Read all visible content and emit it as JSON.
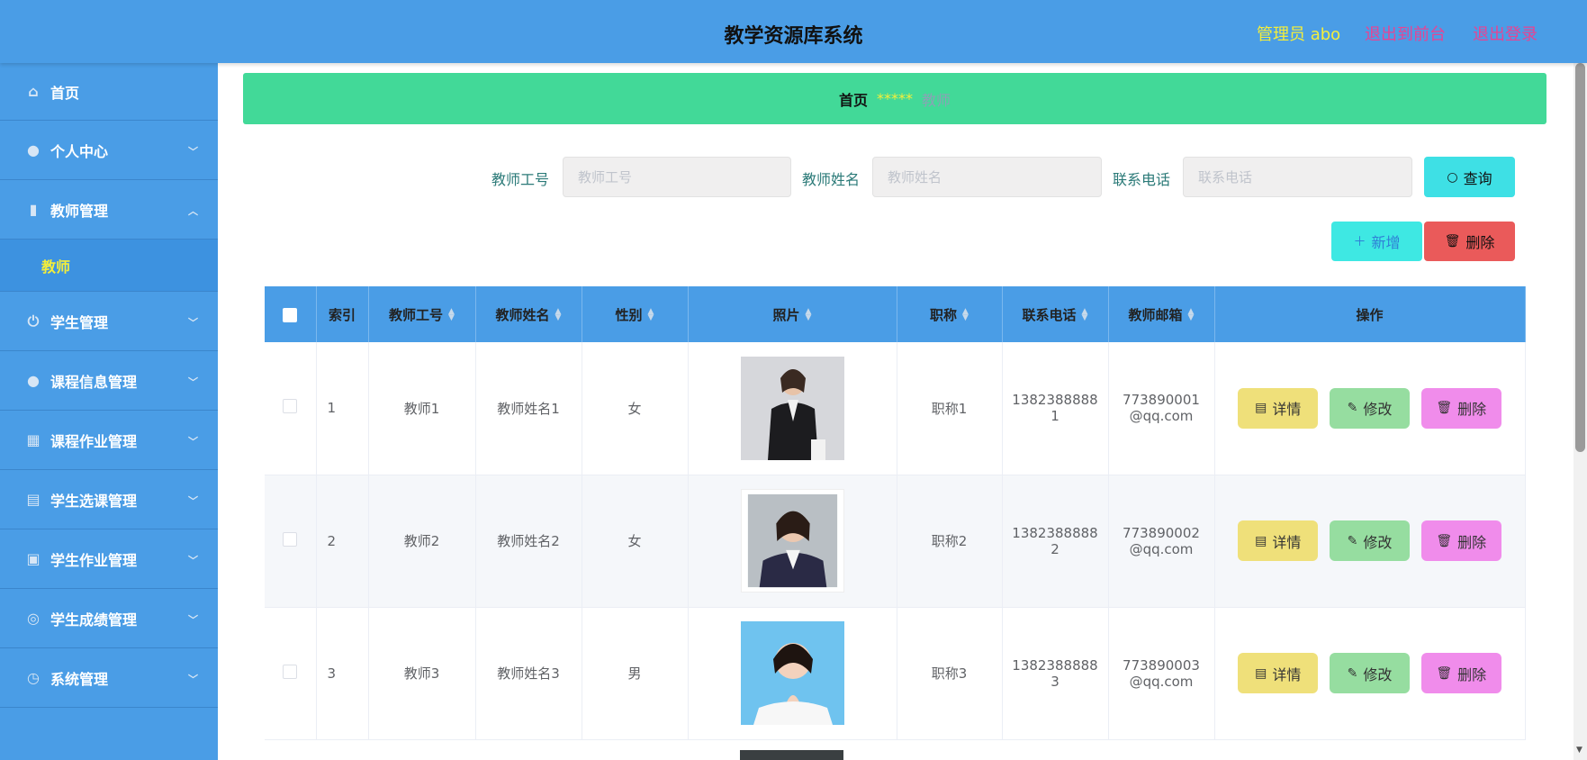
{
  "header": {
    "title": "教学资源库系统",
    "admin": "管理员 abo",
    "to_front": "退出到前台",
    "logout": "退出登录"
  },
  "sidebar": {
    "items": [
      {
        "label": "首页",
        "icon": "home-icon"
      },
      {
        "label": "个人中心",
        "icon": "user-icon"
      },
      {
        "label": "教师管理",
        "icon": "chart-icon",
        "expanded": true,
        "sub": "教师"
      },
      {
        "label": "学生管理",
        "icon": "power-icon"
      },
      {
        "label": "课程信息管理",
        "icon": "user-icon"
      },
      {
        "label": "课程作业管理",
        "icon": "grid-icon"
      },
      {
        "label": "学生选课管理",
        "icon": "clipboard-icon"
      },
      {
        "label": "学生作业管理",
        "icon": "clipboard-check-icon"
      },
      {
        "label": "学生成绩管理",
        "icon": "target-icon"
      },
      {
        "label": "系统管理",
        "icon": "compass-icon"
      }
    ]
  },
  "breadcrumb": {
    "home": "首页",
    "sep": "*****",
    "current": "教师"
  },
  "search": {
    "teacher_id_label": "教师工号",
    "teacher_id_placeholder": "教师工号",
    "teacher_name_label": "教师姓名",
    "teacher_name_placeholder": "教师姓名",
    "phone_label": "联系电话",
    "phone_placeholder": "联系电话",
    "query_label": "查询"
  },
  "toolbar": {
    "add_label": "新增",
    "delete_label": "删除"
  },
  "table": {
    "headers": [
      "索引",
      "教师工号",
      "教师姓名",
      "性别",
      "照片",
      "职称",
      "联系电话",
      "教师邮箱",
      "操作"
    ],
    "rows": [
      {
        "index": "1",
        "id": "教师1",
        "name": "教师姓名1",
        "gender": "女",
        "title": "职称1",
        "phone_a": "1382388888",
        "phone_b": "1",
        "email_a": "773890001",
        "email_b": "@qq.com"
      },
      {
        "index": "2",
        "id": "教师2",
        "name": "教师姓名2",
        "gender": "女",
        "title": "职称2",
        "phone_a": "1382388888",
        "phone_b": "2",
        "email_a": "773890002",
        "email_b": "@qq.com"
      },
      {
        "index": "3",
        "id": "教师3",
        "name": "教师姓名3",
        "gender": "男",
        "title": "职称3",
        "phone_a": "1382388888",
        "phone_b": "3",
        "email_a": "773890003",
        "email_b": "@qq.com"
      }
    ],
    "actions": {
      "detail": "详情",
      "edit": "修改",
      "delete": "删除"
    }
  },
  "colors": {
    "header_bg": "#4a9de6",
    "breadcrumb_bg": "#42d998",
    "accent_yellow": "#f4ee3a",
    "accent_pink": "#e84393",
    "query_btn": "#3ee0e5",
    "delete_btn": "#ea5a5a",
    "detail_btn": "#efe07a",
    "edit_btn": "#96dda0",
    "row_delete_btn": "#f08ceb"
  }
}
